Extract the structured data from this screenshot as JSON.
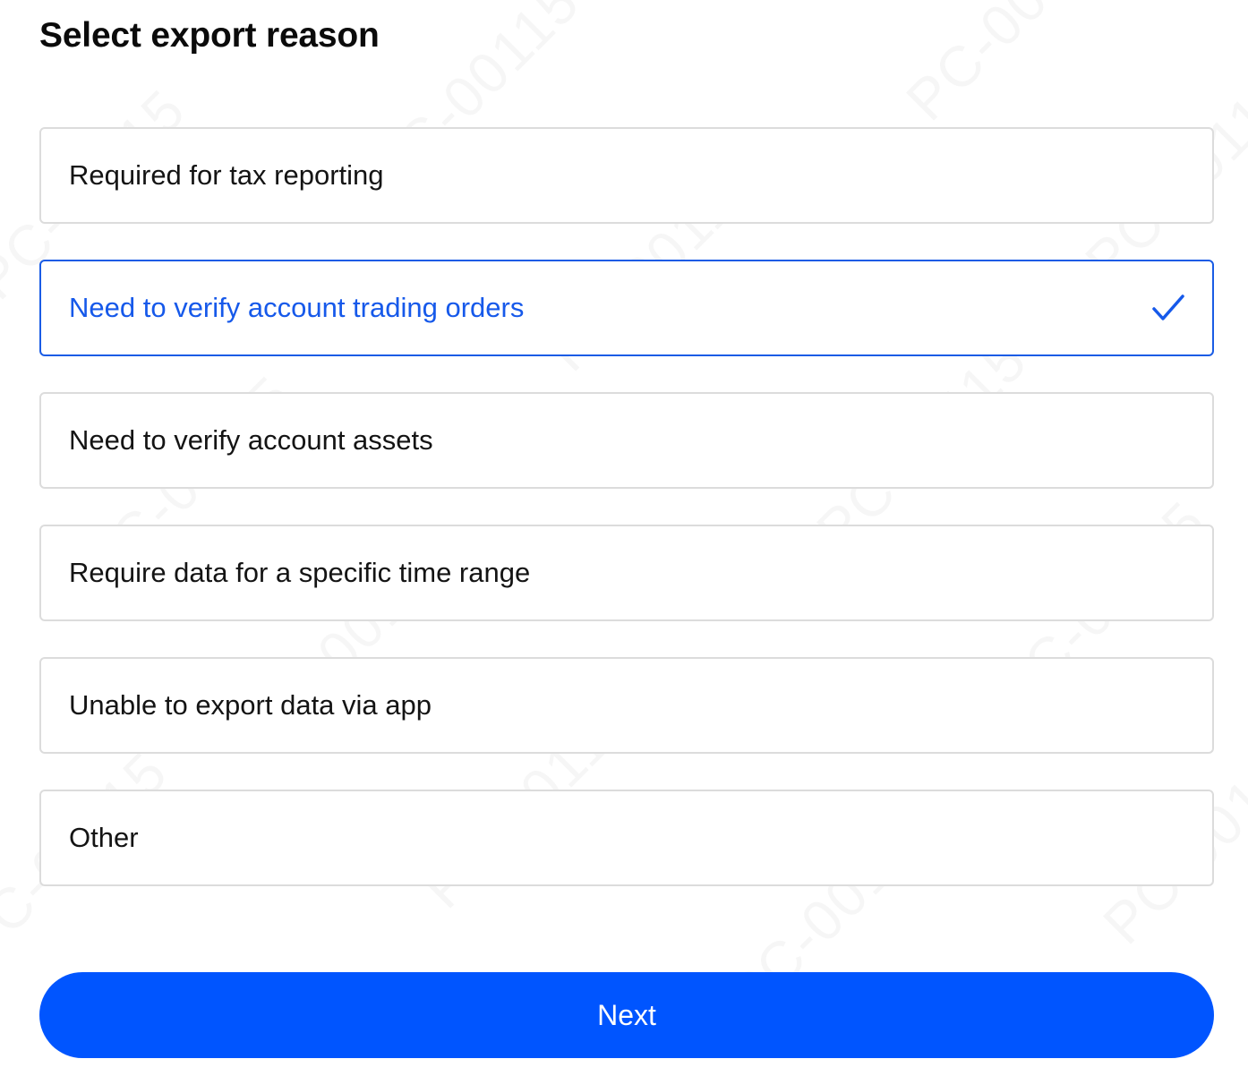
{
  "page": {
    "title": "Select export reason"
  },
  "options": [
    {
      "label": "Required for tax reporting",
      "selected": false
    },
    {
      "label": "Need to verify account trading orders",
      "selected": true
    },
    {
      "label": "Need to verify account assets",
      "selected": false
    },
    {
      "label": "Require data for a specific time range",
      "selected": false
    },
    {
      "label": "Unable to export data via app",
      "selected": false
    },
    {
      "label": "Other",
      "selected": false
    }
  ],
  "actions": {
    "next_label": "Next"
  },
  "watermark": {
    "text": "PC-00115"
  },
  "colors": {
    "accent": "#0055ff",
    "selected_text": "#1659ea",
    "border": "#dcdcdc"
  },
  "icons": {
    "selected_indicator": "checkmark-icon"
  }
}
